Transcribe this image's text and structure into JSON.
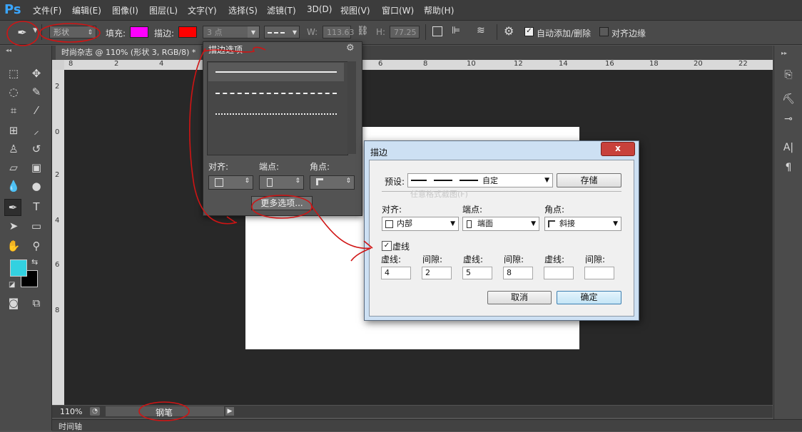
{
  "app": {
    "logo": "Ps"
  },
  "menu": [
    "文件(F)",
    "编辑(E)",
    "图像(I)",
    "图层(L)",
    "文字(Y)",
    "选择(S)",
    "滤镜(T)",
    "3D(D)",
    "视图(V)",
    "窗口(W)",
    "帮助(H)"
  ],
  "options": {
    "mode": "形状",
    "fill_label": "填充:",
    "fill_color": "#ff00ff",
    "stroke_label": "描边:",
    "stroke_color": "#ff0000",
    "stroke_width": "3 点",
    "w_label": "W:",
    "w_value": "113.63",
    "h_label": "H:",
    "h_value": "77.25 ",
    "auto_add_delete": "自动添加/删除",
    "align_edges": "对齐边缘"
  },
  "document": {
    "tab_title": "时尚杂志 @ 110% (形状 3, RGB/8) *",
    "ruler_h": [
      "8",
      "2",
      "4",
      "6",
      "8",
      "10",
      "12",
      "14",
      "16",
      "18",
      "20",
      "22"
    ],
    "ruler_v": [
      "2",
      "0",
      "2",
      "4",
      "6",
      "8"
    ],
    "zoom": "110%",
    "status_tool": "钢笔",
    "timeline": "时间轴"
  },
  "stroke_panel": {
    "title": "描边选项",
    "align_label": "对齐:",
    "caps_label": "端点:",
    "corners_label": "角点:",
    "more_options": "更多选项..."
  },
  "stroke_dialog": {
    "title": "描边",
    "close": "x",
    "preset_label": "预设:",
    "preset_value": "自定",
    "save": "存储",
    "ghost": "任意格式截图(F)",
    "align_label": "对齐:",
    "align_value": "内部",
    "caps_label": "端点:",
    "caps_value": "端面",
    "corners_label": "角点:",
    "corners_value": "斜接",
    "dashed_label": "虚线",
    "dash_labels": [
      "虚线:",
      "间隙:",
      "虚线:",
      "间隙:",
      "虚线:",
      "间隙:"
    ],
    "dash_values": [
      "4",
      "2",
      "5",
      "8",
      "",
      ""
    ],
    "cancel": "取消",
    "ok": "确定"
  },
  "colors": {
    "foreground": "#33d1e0",
    "background": "#000000",
    "annotation": "#d01414"
  }
}
